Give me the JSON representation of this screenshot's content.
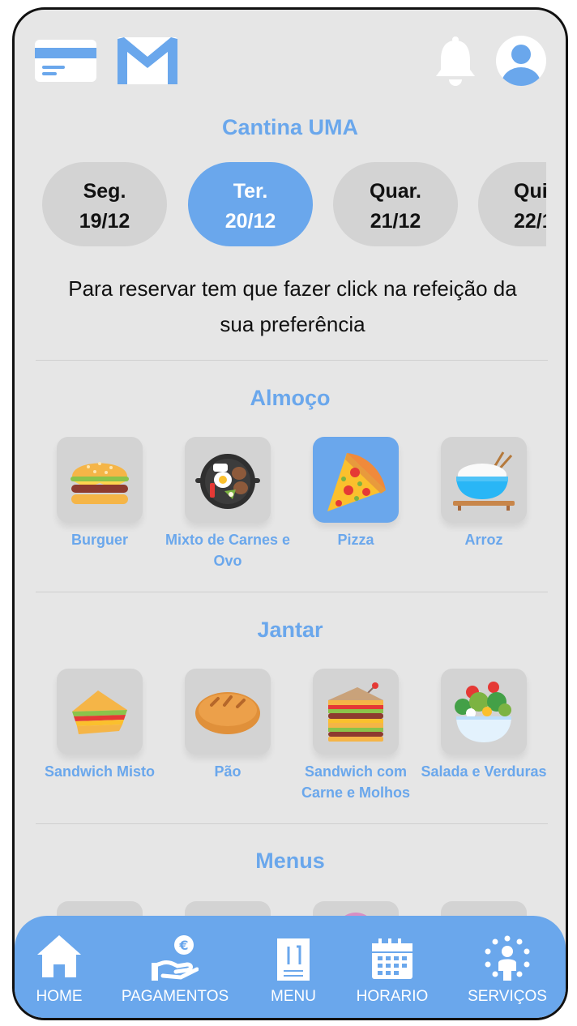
{
  "header": {
    "icons": [
      "card-icon",
      "mail-icon",
      "bell-icon",
      "avatar-icon"
    ],
    "title": "Cantina UMA"
  },
  "days": [
    {
      "name": "Seg.",
      "date": "19/12",
      "active": false
    },
    {
      "name": "Ter.",
      "date": "20/12",
      "active": true
    },
    {
      "name": "Quar.",
      "date": "21/12",
      "active": false
    },
    {
      "name": "Qui",
      "date": "22/1",
      "active": false
    }
  ],
  "instructions": "Para reservar tem que fazer click na refeição da sua preferência",
  "sections": {
    "lunch": {
      "title": "Almoço",
      "items": [
        {
          "label": "Burguer",
          "icon": "burger-icon"
        },
        {
          "label": "Mixto de Carnes e Ovo",
          "icon": "mixed-grill-pan-icon"
        },
        {
          "label": "Pizza",
          "icon": "pizza-slice-icon",
          "selected": true
        },
        {
          "label": "Arroz",
          "icon": "rice-bowl-icon"
        }
      ]
    },
    "dinner": {
      "title": "Jantar",
      "items": [
        {
          "label": "Sandwich Misto",
          "icon": "sandwich-icon"
        },
        {
          "label": "Pão",
          "icon": "bread-icon"
        },
        {
          "label": "Sandwich com Carne e Molhos",
          "icon": "club-sandwich-icon"
        },
        {
          "label": "Salada e Verduras",
          "icon": "salad-bowl-icon"
        }
      ]
    },
    "menus": {
      "title": "Menus"
    }
  },
  "nav": [
    {
      "label": "HOME",
      "icon": "home-icon"
    },
    {
      "label": "PAGAMENTOS",
      "icon": "euro-payment-icon"
    },
    {
      "label": "MENU",
      "icon": "menu-card-icon"
    },
    {
      "label": "HORARIO",
      "icon": "calendar-icon"
    },
    {
      "label": "SERVIÇOS",
      "icon": "services-person-icon"
    }
  ],
  "colors": {
    "accent": "#6aa7ec",
    "background": "#e6e6e6",
    "tile": "#d3d3d3"
  }
}
